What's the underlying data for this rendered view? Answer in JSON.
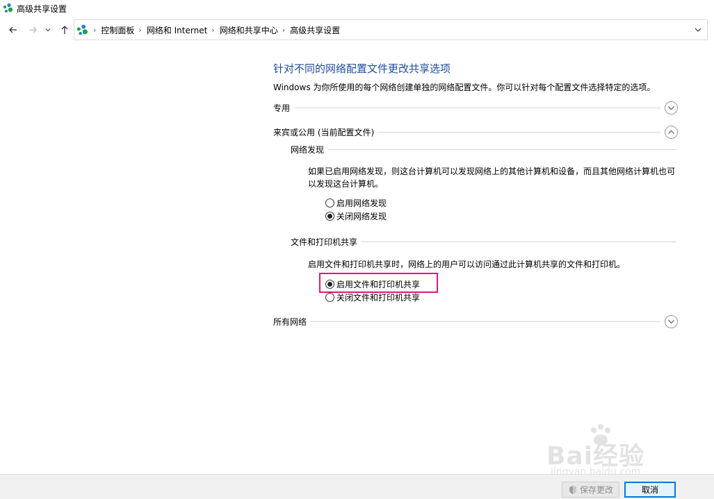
{
  "window": {
    "title": "高级共享设置",
    "icon": "network-sharing-icon"
  },
  "nav": {
    "back_icon": "back-arrow-icon",
    "forward_icon": "forward-arrow-icon",
    "recent_icon": "chevron-down-icon",
    "up_icon": "up-arrow-icon"
  },
  "address": {
    "breadcrumbs": [
      "控制面板",
      "网络和 Internet",
      "网络和共享中心",
      "高级共享设置"
    ],
    "dropdown_icon": "chevron-down-icon"
  },
  "main": {
    "title": "针对不同的网络配置文件更改共享选项",
    "description": "Windows 为你所使用的每个网络创建单独的网络配置文件。你可以针对每个配置文件选择特定的选项。",
    "profiles": {
      "private": {
        "label": "专用",
        "state": "collapsed"
      },
      "guest_public": {
        "label": "来宾或公用 (当前配置文件)",
        "state": "expanded",
        "network_discovery": {
          "heading": "网络发现",
          "description": "如果已启用网络发现，则这台计算机可以发现网络上的其他计算机和设备，而且其他网络计算机也可以发现这台计算机。",
          "options": [
            {
              "label": "启用网络发现",
              "selected": false
            },
            {
              "label": "关闭网络发现",
              "selected": true
            }
          ]
        },
        "file_printer_sharing": {
          "heading": "文件和打印机共享",
          "description": "启用文件和打印机共享时，网络上的用户可以访问通过此计算机共享的文件和打印机。",
          "options": [
            {
              "label": "启用文件和打印机共享",
              "selected": true
            },
            {
              "label": "关闭文件和打印机共享",
              "selected": false
            }
          ]
        }
      },
      "all_networks": {
        "label": "所有网络",
        "state": "collapsed"
      }
    }
  },
  "footer": {
    "save_label": "保存更改",
    "save_icon": "uac-shield-icon",
    "cancel_label": "取消"
  },
  "watermark": {
    "brand": "Bai经验",
    "url": "jingyan.baidu.com"
  },
  "colors": {
    "title_blue": "#1e4d9c",
    "highlight": "#e0147a",
    "default_button_border": "#0078d7"
  }
}
